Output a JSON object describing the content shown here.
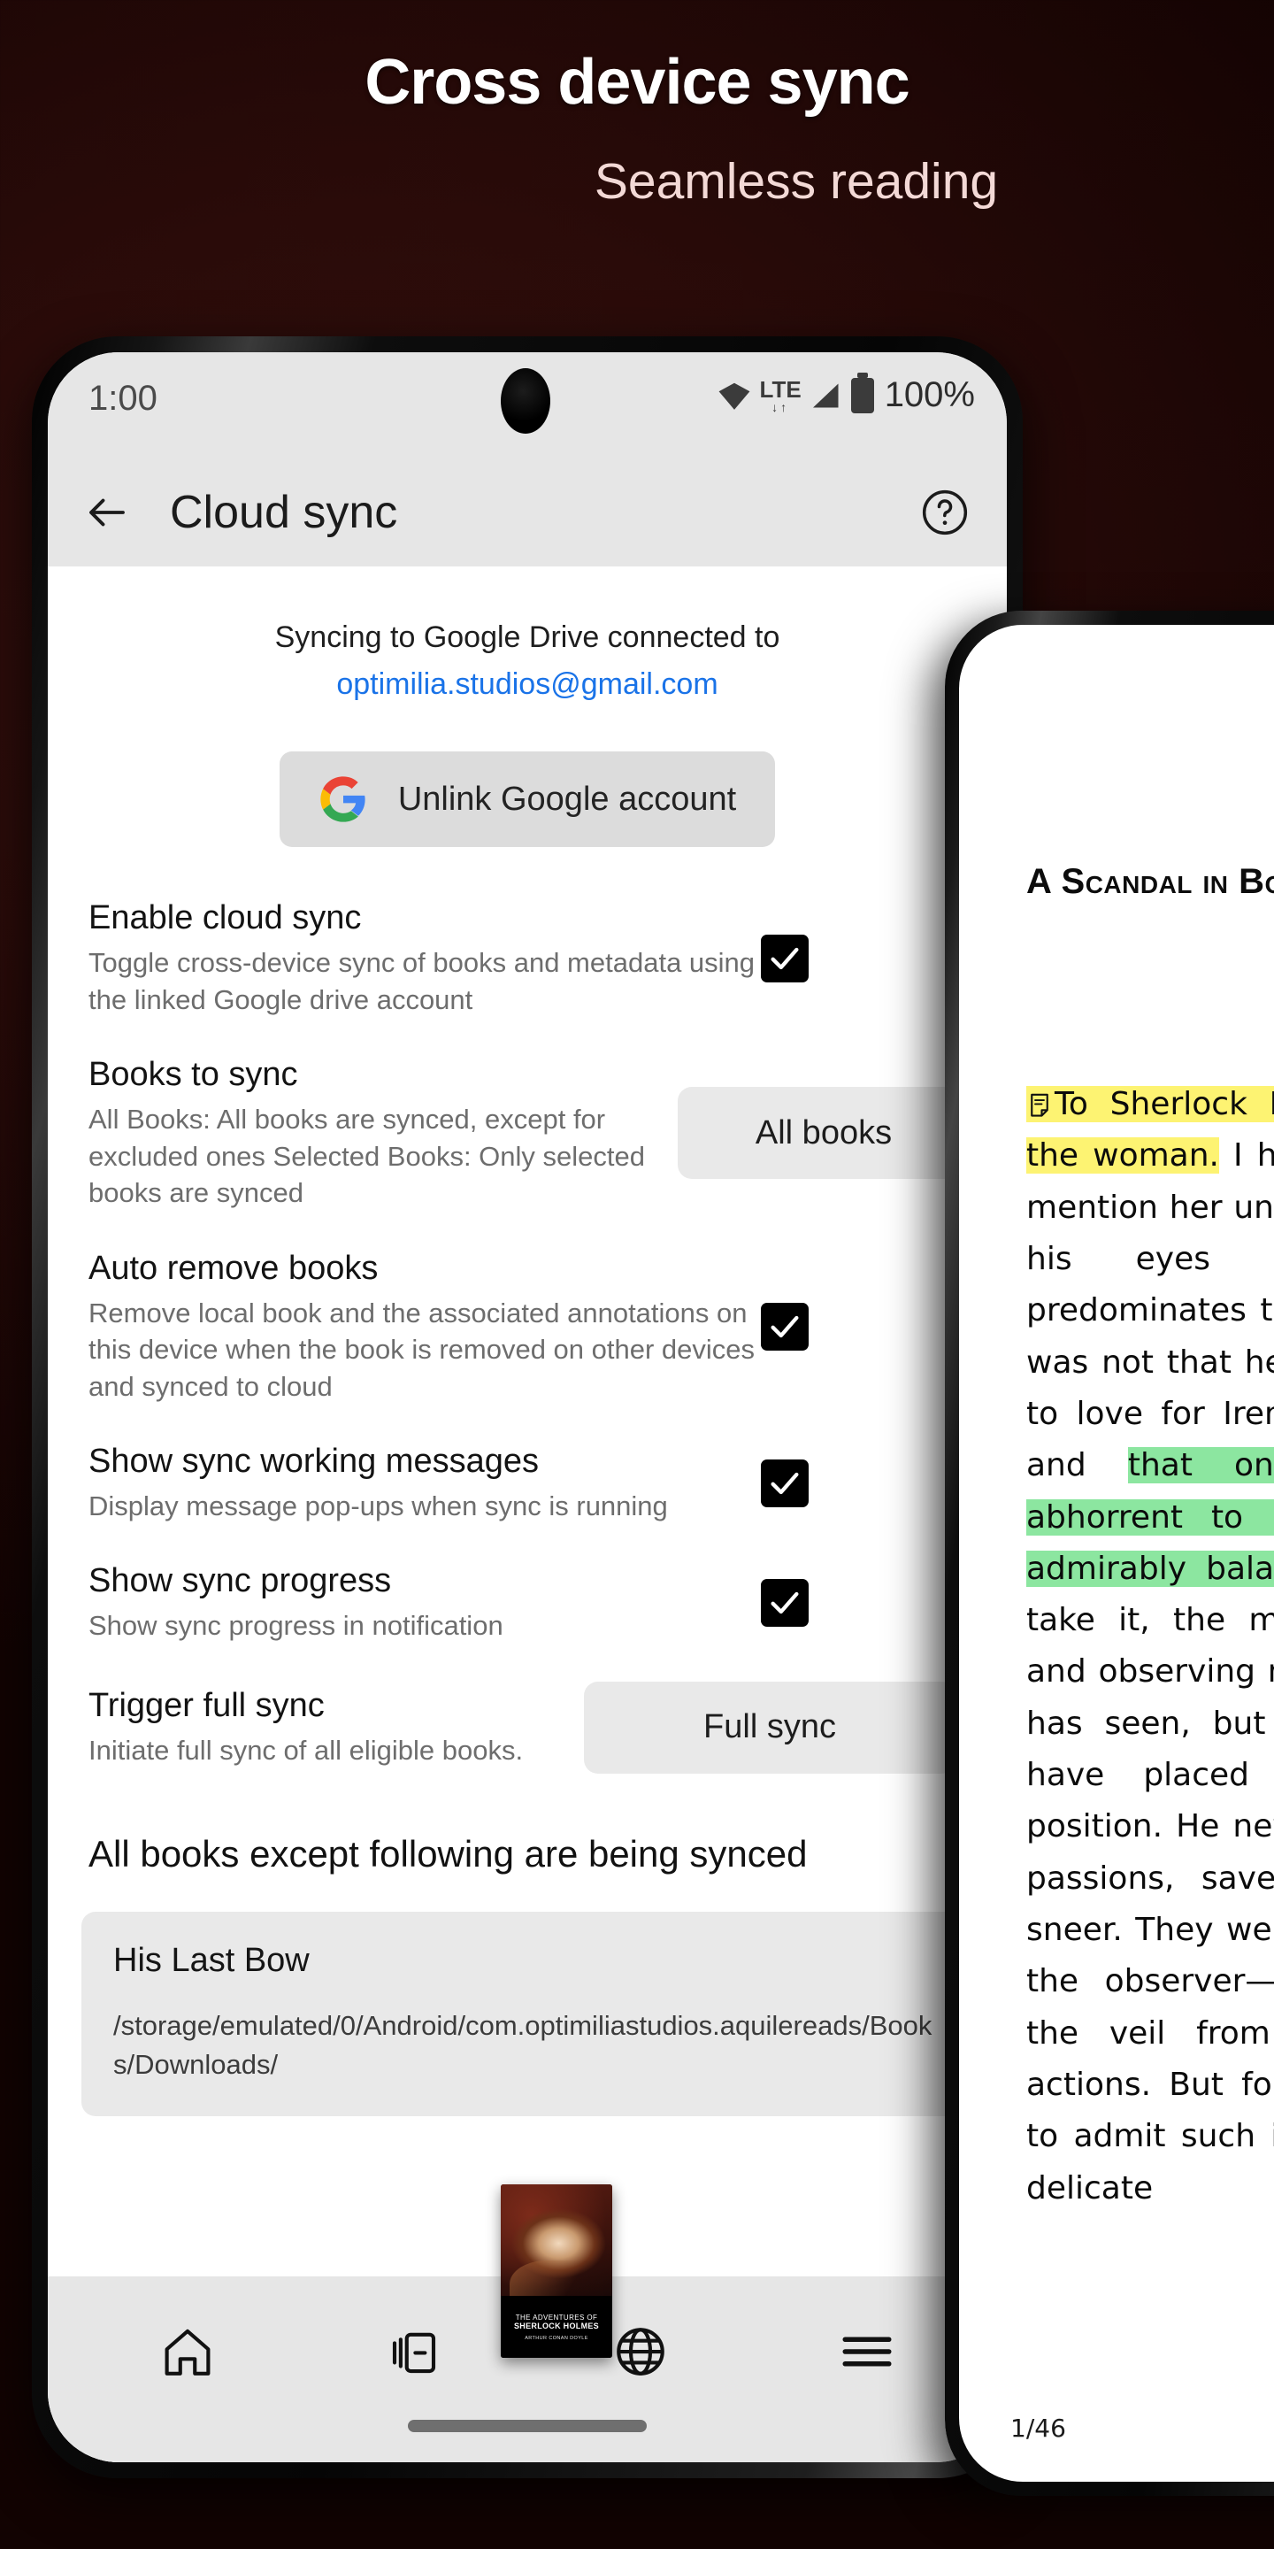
{
  "promo": {
    "title": "Cross device sync",
    "subtitle": "Seamless reading"
  },
  "phone1": {
    "status_bar": {
      "time": "1:00",
      "network_type": "LTE",
      "battery_percent": "100%",
      "icons": [
        "wifi-icon",
        "lte-icon",
        "signal-icon",
        "battery-icon"
      ]
    },
    "app_bar": {
      "back_label": "back-arrow-icon",
      "title": "Cloud sync",
      "help_label": "help-icon"
    },
    "sync_status": {
      "line1": "Syncing to Google Drive connected to",
      "email": "optimilia.studios@gmail.com"
    },
    "unlink_button": {
      "label": "Unlink Google account",
      "icon": "google-logo-icon"
    },
    "settings": [
      {
        "title": "Enable cloud sync",
        "description": "Toggle cross-device sync of books and metadata using the linked Google drive account",
        "control": "checkbox",
        "checked": true
      },
      {
        "title": "Books to sync",
        "description": "All Books: All books are synced, except for excluded ones Selected Books: Only selected books are synced",
        "control": "button",
        "value": "All books"
      },
      {
        "title": "Auto remove books",
        "description": "Remove local book and the associated annotations on this device when the book is removed on other devices and synced to cloud",
        "control": "checkbox",
        "checked": true
      },
      {
        "title": "Show sync working messages",
        "description": "Display message pop-ups when sync is running",
        "control": "checkbox",
        "checked": true
      },
      {
        "title": "Show sync progress",
        "description": "Show sync progress in notification",
        "control": "checkbox",
        "checked": true
      },
      {
        "title": "Trigger full sync",
        "description": "Initiate full sync of all eligible books.",
        "control": "button",
        "value": "Full sync"
      }
    ],
    "excluded_section": {
      "heading": "All books except following are being synced",
      "book": {
        "title": "His Last Bow",
        "path": "/storage/emulated/0/Android/com.optimiliastudios.aquilereads/Books/Downloads/"
      }
    },
    "nav_bar": {
      "items": [
        "home-icon",
        "library-icon",
        "globe-icon",
        "menu-icon"
      ]
    },
    "floating_cover": {
      "line1": "THE ADVENTURES OF",
      "line2": "SHERLOCK HOLMES",
      "line3": "ARTHUR CONAN DOYLE"
    }
  },
  "phone2": {
    "chapter_title": "A Scandal in Bohemia",
    "paragraph": {
      "highlight_yellow": "To Sherlock Holmes she is always the woman.",
      "part2": " I have seldom heard him mention her under any other name. In his eyes she eclipses and predominates the whole of her sex. It was not that he felt any emotion akin to love for Irene Adler. All emotions, and ",
      "highlight_green": "that one particularly, were abhorrent to his cold, precise but admirably balanced mind.",
      "part3": " He was, I take it, the most perfect reasoning and observing machine that the world has seen, but as a lover he would have placed himself in a false position. He never spoke of the softer passions, save with a gibe and a sneer. They were admirable things for the observer—excellent for drawing the veil from men's motives and actions. But for the trained reasoner to admit such intrusions into his own delicate"
    },
    "page_indicator": "1/46"
  }
}
